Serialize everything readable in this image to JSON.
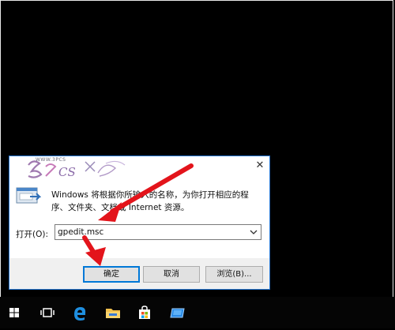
{
  "dialog": {
    "close_glyph": "✕",
    "watermark_text": "WWW.3PCS",
    "description": "Windows 将根据你所输入的名称，为你打开相应的程序、文件夹、文档或 Internet 资源。",
    "open_label": "打开(O):",
    "command_value": "gpedit.msc",
    "buttons": {
      "ok": "确定",
      "cancel": "取消",
      "browse": "浏览(B)..."
    }
  },
  "taskbar": {
    "icons": [
      "windows-start-icon",
      "task-view-icon",
      "edge-browser-icon",
      "file-explorer-icon",
      "store-icon",
      "screen-icon"
    ]
  },
  "colors": {
    "annotation_arrow": "#e3141b",
    "dialog_border": "#2b7bd6",
    "focus_blue": "#0078d7"
  }
}
